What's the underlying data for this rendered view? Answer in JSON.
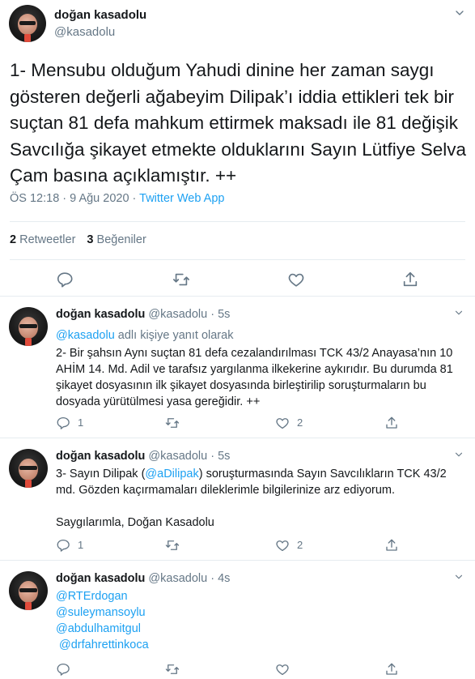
{
  "main_tweet": {
    "author_name": "doğan kasadolu",
    "author_handle": "@kasadolu",
    "text": "1- Mensubu olduğum Yahudi dinine her zaman saygı gösteren değerli ağabeyim Dilipak’ı iddia ettikleri tek bir suçtan 81 defa mahkum ettirmek maksadı ile 81 değişik Savcılığa şikayet etmekte olduklarını Sayın Lütfiye Selva Çam basına açıklamıştır. ++",
    "time": "ÖS 12:18 · 9 Ağu 2020 · ",
    "source": "Twitter Web App",
    "retweet_count": "2",
    "retweet_label": "Retweetler",
    "like_count": "3",
    "like_label": "Beğeniler"
  },
  "replies": [
    {
      "author_name": "doğan kasadolu",
      "author_handle": "@kasadolu",
      "age": "5s",
      "reply_to_handle": "@kasadolu",
      "reply_to_suffix": " adlı kişiye yanıt olarak",
      "text": "2- Bir şahsın Aynı suçtan 81 defa cezalandırılması TCK 43/2 Anayasa’nın 10 AHİM 14. Md. Adil ve tarafsız yargılanma ilkekerine aykırıdır. Bu durumda 81 şikayet dosyasının ilk şikayet dosyasında birleştirilip soruşturmaların bu dosyada yürütülmesi yasa gereğidir. ++",
      "reply_count": "1",
      "retweet_count": "",
      "like_count": "2"
    },
    {
      "author_name": "doğan kasadolu",
      "author_handle": "@kasadolu",
      "age": "5s",
      "text_before": "3- Sayın Dilipak (",
      "mention": "@aDilipak",
      "text_after": ") soruşturmasında Sayın Savcılıkların TCK 43/2 md.  Gözden kaçırmamaları dileklerimle bilgilerinize arz ediyorum.",
      "signature": "Saygılarımla, Doğan Kasadolu",
      "reply_count": "1",
      "retweet_count": "",
      "like_count": "2"
    },
    {
      "author_name": "doğan kasadolu",
      "author_handle": "@kasadolu",
      "age": "4s",
      "mentions": [
        "@RTErdogan",
        "@suleymansoylu",
        "@abdulhamitgul",
        " @drfahrettinkoca"
      ],
      "reply_count": "",
      "retweet_count": "",
      "like_count": ""
    }
  ],
  "colors": {
    "accent": "#1da1f2",
    "secondary_text": "#657786",
    "border": "#e6ecf0",
    "thread_line": "#ccd6dd"
  },
  "icons": [
    "chevron-down-icon",
    "reply-icon",
    "retweet-icon",
    "like-icon",
    "share-icon"
  ]
}
